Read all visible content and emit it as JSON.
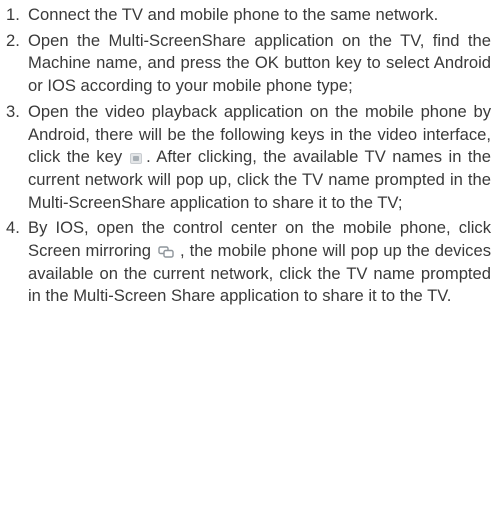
{
  "steps": [
    {
      "number": "1.",
      "text": "Connect the TV and mobile phone to the same network."
    },
    {
      "number": "2.",
      "text": "Open the Multi-ScreenShare application on the TV, find the Machine name, and press the OK button key to select Android or IOS according to your mobile phone type;"
    },
    {
      "number": "3.",
      "text_before": "Open the video playback application on the mobile phone by Android, there will be the following keys in the video interface, click the key",
      "icon": "cast-screen-icon",
      "text_after": ". After clicking, the available TV names in the current network will pop up, click the TV name prompted in the Multi-ScreenShare application to share it to the TV;"
    },
    {
      "number": "4.",
      "text_before": "By IOS, open the control center on the mobile phone, click Screen mirroring",
      "icon": "screen-mirroring-icon",
      "text_after": ", the mobile phone will pop up the devices available on the current network, click the TV name prompted in the Multi-Screen Share application to share it to the TV."
    }
  ]
}
